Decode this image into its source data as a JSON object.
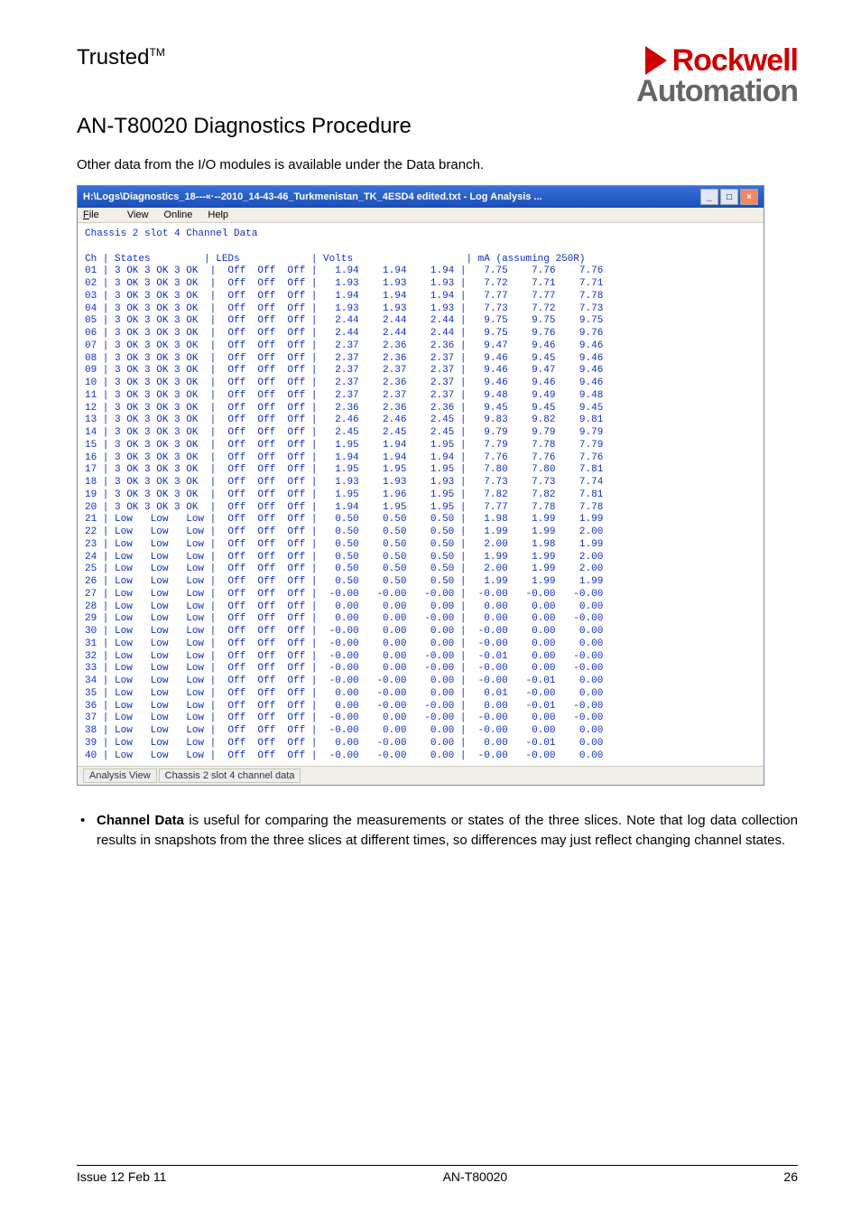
{
  "header": {
    "brand": "Trusted",
    "brand_tm": "TM",
    "logo_line1": "Rockwell",
    "logo_line2": "Automation",
    "doc_title": "AN-T80020 Diagnostics Procedure",
    "intro": "Other data from the I/O modules is available under the Data branch."
  },
  "log_window": {
    "titlebar": "H:\\Logs\\Diagnostics_18---«·--2010_14-43-46_Turkmenistan_TK_4ESD4 edited.txt - Log Analysis ...",
    "menu": {
      "file": "File",
      "view": "View",
      "online": "Online",
      "help": "Help"
    },
    "heading": "Chassis 2 slot 4 Channel Data",
    "col_header": "Ch | States         | LEDs            | Volts                   | mA (assuming 250R)",
    "status": {
      "cell1": "Analysis View",
      "cell2": "Chassis 2 slot 4 channel data"
    },
    "rows": [
      {
        "ch": "01",
        "states": "3 OK 3 OK 3 OK",
        "leds": [
          "Off",
          "Off",
          "Off"
        ],
        "volts": [
          "1.94",
          "1.94",
          "1.94"
        ],
        "ma": [
          "7.75",
          "7.76",
          "7.76"
        ]
      },
      {
        "ch": "02",
        "states": "3 OK 3 OK 3 OK",
        "leds": [
          "Off",
          "Off",
          "Off"
        ],
        "volts": [
          "1.93",
          "1.93",
          "1.93"
        ],
        "ma": [
          "7.72",
          "7.71",
          "7.71"
        ]
      },
      {
        "ch": "03",
        "states": "3 OK 3 OK 3 OK",
        "leds": [
          "Off",
          "Off",
          "Off"
        ],
        "volts": [
          "1.94",
          "1.94",
          "1.94"
        ],
        "ma": [
          "7.77",
          "7.77",
          "7.78"
        ]
      },
      {
        "ch": "04",
        "states": "3 OK 3 OK 3 OK",
        "leds": [
          "Off",
          "Off",
          "Off"
        ],
        "volts": [
          "1.93",
          "1.93",
          "1.93"
        ],
        "ma": [
          "7.73",
          "7.72",
          "7.73"
        ]
      },
      {
        "ch": "05",
        "states": "3 OK 3 OK 3 OK",
        "leds": [
          "Off",
          "Off",
          "Off"
        ],
        "volts": [
          "2.44",
          "2.44",
          "2.44"
        ],
        "ma": [
          "9.75",
          "9.75",
          "9.75"
        ]
      },
      {
        "ch": "06",
        "states": "3 OK 3 OK 3 OK",
        "leds": [
          "Off",
          "Off",
          "Off"
        ],
        "volts": [
          "2.44",
          "2.44",
          "2.44"
        ],
        "ma": [
          "9.75",
          "9.76",
          "9.76"
        ]
      },
      {
        "ch": "07",
        "states": "3 OK 3 OK 3 OK",
        "leds": [
          "Off",
          "Off",
          "Off"
        ],
        "volts": [
          "2.37",
          "2.36",
          "2.36"
        ],
        "ma": [
          "9.47",
          "9.46",
          "9.46"
        ]
      },
      {
        "ch": "08",
        "states": "3 OK 3 OK 3 OK",
        "leds": [
          "Off",
          "Off",
          "Off"
        ],
        "volts": [
          "2.37",
          "2.36",
          "2.37"
        ],
        "ma": [
          "9.46",
          "9.45",
          "9.46"
        ]
      },
      {
        "ch": "09",
        "states": "3 OK 3 OK 3 OK",
        "leds": [
          "Off",
          "Off",
          "Off"
        ],
        "volts": [
          "2.37",
          "2.37",
          "2.37"
        ],
        "ma": [
          "9.46",
          "9.47",
          "9.46"
        ]
      },
      {
        "ch": "10",
        "states": "3 OK 3 OK 3 OK",
        "leds": [
          "Off",
          "Off",
          "Off"
        ],
        "volts": [
          "2.37",
          "2.36",
          "2.37"
        ],
        "ma": [
          "9.46",
          "9.46",
          "9.46"
        ]
      },
      {
        "ch": "11",
        "states": "3 OK 3 OK 3 OK",
        "leds": [
          "Off",
          "Off",
          "Off"
        ],
        "volts": [
          "2.37",
          "2.37",
          "2.37"
        ],
        "ma": [
          "9.48",
          "9.49",
          "9.48"
        ]
      },
      {
        "ch": "12",
        "states": "3 OK 3 OK 3 OK",
        "leds": [
          "Off",
          "Off",
          "Off"
        ],
        "volts": [
          "2.36",
          "2.36",
          "2.36"
        ],
        "ma": [
          "9.45",
          "9.45",
          "9.45"
        ]
      },
      {
        "ch": "13",
        "states": "3 OK 3 OK 3 OK",
        "leds": [
          "Off",
          "Off",
          "Off"
        ],
        "volts": [
          "2.46",
          "2.46",
          "2.45"
        ],
        "ma": [
          "9.83",
          "9.82",
          "9.81"
        ]
      },
      {
        "ch": "14",
        "states": "3 OK 3 OK 3 OK",
        "leds": [
          "Off",
          "Off",
          "Off"
        ],
        "volts": [
          "2.45",
          "2.45",
          "2.45"
        ],
        "ma": [
          "9.79",
          "9.79",
          "9.79"
        ]
      },
      {
        "ch": "15",
        "states": "3 OK 3 OK 3 OK",
        "leds": [
          "Off",
          "Off",
          "Off"
        ],
        "volts": [
          "1.95",
          "1.94",
          "1.95"
        ],
        "ma": [
          "7.79",
          "7.78",
          "7.79"
        ]
      },
      {
        "ch": "16",
        "states": "3 OK 3 OK 3 OK",
        "leds": [
          "Off",
          "Off",
          "Off"
        ],
        "volts": [
          "1.94",
          "1.94",
          "1.94"
        ],
        "ma": [
          "7.76",
          "7.76",
          "7.76"
        ]
      },
      {
        "ch": "17",
        "states": "3 OK 3 OK 3 OK",
        "leds": [
          "Off",
          "Off",
          "Off"
        ],
        "volts": [
          "1.95",
          "1.95",
          "1.95"
        ],
        "ma": [
          "7.80",
          "7.80",
          "7.81"
        ]
      },
      {
        "ch": "18",
        "states": "3 OK 3 OK 3 OK",
        "leds": [
          "Off",
          "Off",
          "Off"
        ],
        "volts": [
          "1.93",
          "1.93",
          "1.93"
        ],
        "ma": [
          "7.73",
          "7.73",
          "7.74"
        ]
      },
      {
        "ch": "19",
        "states": "3 OK 3 OK 3 OK",
        "leds": [
          "Off",
          "Off",
          "Off"
        ],
        "volts": [
          "1.95",
          "1.96",
          "1.95"
        ],
        "ma": [
          "7.82",
          "7.82",
          "7.81"
        ]
      },
      {
        "ch": "20",
        "states": "3 OK 3 OK 3 OK",
        "leds": [
          "Off",
          "Off",
          "Off"
        ],
        "volts": [
          "1.94",
          "1.95",
          "1.95"
        ],
        "ma": [
          "7.77",
          "7.78",
          "7.78"
        ]
      },
      {
        "ch": "21",
        "states": "Low   Low   Low",
        "leds": [
          "Off",
          "Off",
          "Off"
        ],
        "volts": [
          "0.50",
          "0.50",
          "0.50"
        ],
        "ma": [
          "1.98",
          "1.99",
          "1.99"
        ]
      },
      {
        "ch": "22",
        "states": "Low   Low   Low",
        "leds": [
          "Off",
          "Off",
          "Off"
        ],
        "volts": [
          "0.50",
          "0.50",
          "0.50"
        ],
        "ma": [
          "1.99",
          "1.99",
          "2.00"
        ]
      },
      {
        "ch": "23",
        "states": "Low   Low   Low",
        "leds": [
          "Off",
          "Off",
          "Off"
        ],
        "volts": [
          "0.50",
          "0.50",
          "0.50"
        ],
        "ma": [
          "2.00",
          "1.98",
          "1.99"
        ]
      },
      {
        "ch": "24",
        "states": "Low   Low   Low",
        "leds": [
          "Off",
          "Off",
          "Off"
        ],
        "volts": [
          "0.50",
          "0.50",
          "0.50"
        ],
        "ma": [
          "1.99",
          "1.99",
          "2.00"
        ]
      },
      {
        "ch": "25",
        "states": "Low   Low   Low",
        "leds": [
          "Off",
          "Off",
          "Off"
        ],
        "volts": [
          "0.50",
          "0.50",
          "0.50"
        ],
        "ma": [
          "2.00",
          "1.99",
          "2.00"
        ]
      },
      {
        "ch": "26",
        "states": "Low   Low   Low",
        "leds": [
          "Off",
          "Off",
          "Off"
        ],
        "volts": [
          "0.50",
          "0.50",
          "0.50"
        ],
        "ma": [
          "1.99",
          "1.99",
          "1.99"
        ]
      },
      {
        "ch": "27",
        "states": "Low   Low   Low",
        "leds": [
          "Off",
          "Off",
          "Off"
        ],
        "volts": [
          "-0.00",
          "-0.00",
          "-0.00"
        ],
        "ma": [
          "-0.00",
          "-0.00",
          "-0.00"
        ]
      },
      {
        "ch": "28",
        "states": "Low   Low   Low",
        "leds": [
          "Off",
          "Off",
          "Off"
        ],
        "volts": [
          "0.00",
          "0.00",
          "0.00"
        ],
        "ma": [
          "0.00",
          "0.00",
          "0.00"
        ]
      },
      {
        "ch": "29",
        "states": "Low   Low   Low",
        "leds": [
          "Off",
          "Off",
          "Off"
        ],
        "volts": [
          "0.00",
          "0.00",
          "-0.00"
        ],
        "ma": [
          "0.00",
          "0.00",
          "-0.00"
        ]
      },
      {
        "ch": "30",
        "states": "Low   Low   Low",
        "leds": [
          "Off",
          "Off",
          "Off"
        ],
        "volts": [
          "-0.00",
          "0.00",
          "0.00"
        ],
        "ma": [
          "-0.00",
          "0.00",
          "0.00"
        ]
      },
      {
        "ch": "31",
        "states": "Low   Low   Low",
        "leds": [
          "Off",
          "Off",
          "Off"
        ],
        "volts": [
          "-0.00",
          "0.00",
          "0.00"
        ],
        "ma": [
          "-0.00",
          "0.00",
          "0.00"
        ]
      },
      {
        "ch": "32",
        "states": "Low   Low   Low",
        "leds": [
          "Off",
          "Off",
          "Off"
        ],
        "volts": [
          "-0.00",
          "0.00",
          "-0.00"
        ],
        "ma": [
          "-0.01",
          "0.00",
          "-0.00"
        ]
      },
      {
        "ch": "33",
        "states": "Low   Low   Low",
        "leds": [
          "Off",
          "Off",
          "Off"
        ],
        "volts": [
          "-0.00",
          "0.00",
          "-0.00"
        ],
        "ma": [
          "-0.00",
          "0.00",
          "-0.00"
        ]
      },
      {
        "ch": "34",
        "states": "Low   Low   Low",
        "leds": [
          "Off",
          "Off",
          "Off"
        ],
        "volts": [
          "-0.00",
          "-0.00",
          "0.00"
        ],
        "ma": [
          "-0.00",
          "-0.01",
          "0.00"
        ]
      },
      {
        "ch": "35",
        "states": "Low   Low   Low",
        "leds": [
          "Off",
          "Off",
          "Off"
        ],
        "volts": [
          "0.00",
          "-0.00",
          "0.00"
        ],
        "ma": [
          "0.01",
          "-0.00",
          "0.00"
        ]
      },
      {
        "ch": "36",
        "states": "Low   Low   Low",
        "leds": [
          "Off",
          "Off",
          "Off"
        ],
        "volts": [
          "0.00",
          "-0.00",
          "-0.00"
        ],
        "ma": [
          "0.00",
          "-0.01",
          "-0.00"
        ]
      },
      {
        "ch": "37",
        "states": "Low   Low   Low",
        "leds": [
          "Off",
          "Off",
          "Off"
        ],
        "volts": [
          "-0.00",
          "0.00",
          "-0.00"
        ],
        "ma": [
          "-0.00",
          "0.00",
          "-0.00"
        ]
      },
      {
        "ch": "38",
        "states": "Low   Low   Low",
        "leds": [
          "Off",
          "Off",
          "Off"
        ],
        "volts": [
          "-0.00",
          "0.00",
          "0.00"
        ],
        "ma": [
          "-0.00",
          "0.00",
          "0.00"
        ]
      },
      {
        "ch": "39",
        "states": "Low   Low   Low",
        "leds": [
          "Off",
          "Off",
          "Off"
        ],
        "volts": [
          "0.00",
          "-0.00",
          "0.00"
        ],
        "ma": [
          "0.00",
          "-0.01",
          "0.00"
        ]
      },
      {
        "ch": "40",
        "states": "Low   Low   Low",
        "leds": [
          "Off",
          "Off",
          "Off"
        ],
        "volts": [
          "-0.00",
          "-0.00",
          "0.00"
        ],
        "ma": [
          "-0.00",
          "-0.00",
          "0.00"
        ]
      }
    ]
  },
  "bullet": {
    "bold": "Channel Data",
    "rest": " is useful for comparing the measurements or states of the three slices. Note that log data collection results in snapshots from the three slices at different times, so differences may just reflect changing channel states."
  },
  "footer": {
    "left": "Issue 12 Feb 11",
    "center": "AN-T80020",
    "right": "26"
  }
}
